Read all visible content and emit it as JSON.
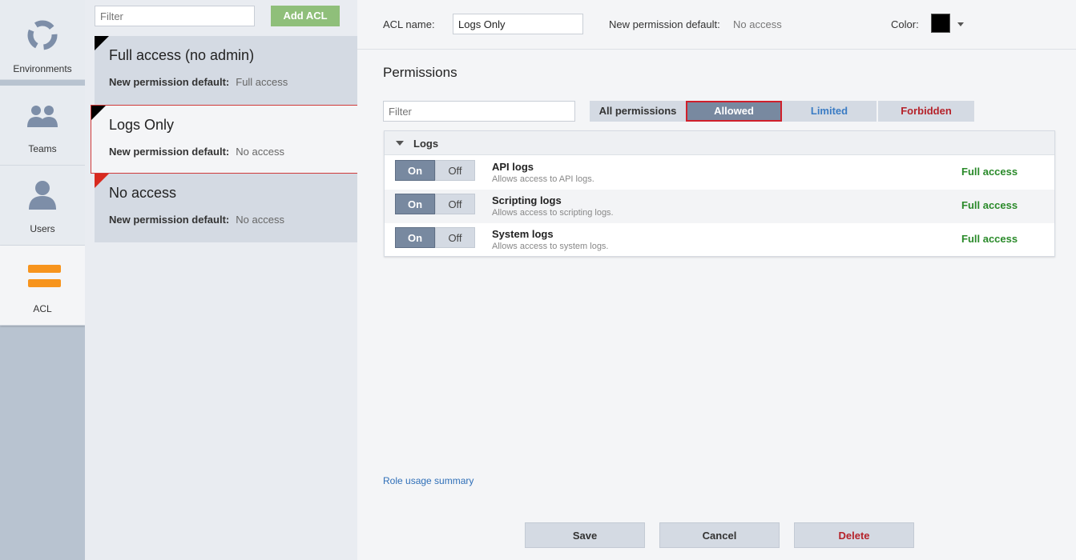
{
  "nav": {
    "items": [
      {
        "label": "Environments",
        "icon": "environments-icon"
      },
      {
        "label": "Teams",
        "icon": "teams-icon"
      },
      {
        "label": "Users",
        "icon": "users-icon"
      },
      {
        "label": "ACL",
        "icon": "acl-icon"
      }
    ],
    "active": "ACL"
  },
  "acl_list": {
    "filter_placeholder": "Filter",
    "add_label": "Add ACL",
    "default_label": "New permission default:",
    "items": [
      {
        "name": "Full access (no admin)",
        "default": "Full access",
        "corner_color": "#000000"
      },
      {
        "name": "Logs Only",
        "default": "No access",
        "corner_color": "#000000",
        "selected": true
      },
      {
        "name": "No access",
        "default": "No access",
        "corner_color": "#d82a1f"
      }
    ]
  },
  "editor": {
    "acl_name_label": "ACL name:",
    "acl_name_value": "Logs Only",
    "default_label": "New permission default:",
    "default_value": "No access",
    "color_label": "Color:",
    "color_value": "#000000",
    "permissions_title": "Permissions",
    "filter_placeholder": "Filter",
    "tabs": [
      {
        "label": "All permissions"
      },
      {
        "label": "Allowed",
        "active": true
      },
      {
        "label": "Limited"
      },
      {
        "label": "Forbidden"
      }
    ],
    "group": {
      "title": "Logs",
      "rows": [
        {
          "name": "API logs",
          "desc": "Allows access to API logs.",
          "on": "On",
          "off": "Off",
          "level": "Full access"
        },
        {
          "name": "Scripting logs",
          "desc": "Allows access to scripting logs.",
          "on": "On",
          "off": "Off",
          "level": "Full access"
        },
        {
          "name": "System logs",
          "desc": "Allows access to system logs.",
          "on": "On",
          "off": "Off",
          "level": "Full access"
        }
      ]
    },
    "summary_link": "Role usage summary",
    "buttons": {
      "save": "Save",
      "cancel": "Cancel",
      "delete": "Delete"
    }
  },
  "colors": {
    "accent": "#7889a0",
    "allowed_border": "#d0202b",
    "full_access": "#2a8a2a",
    "add_button": "#8fbf7a",
    "acl_orange": "#f7941d"
  }
}
